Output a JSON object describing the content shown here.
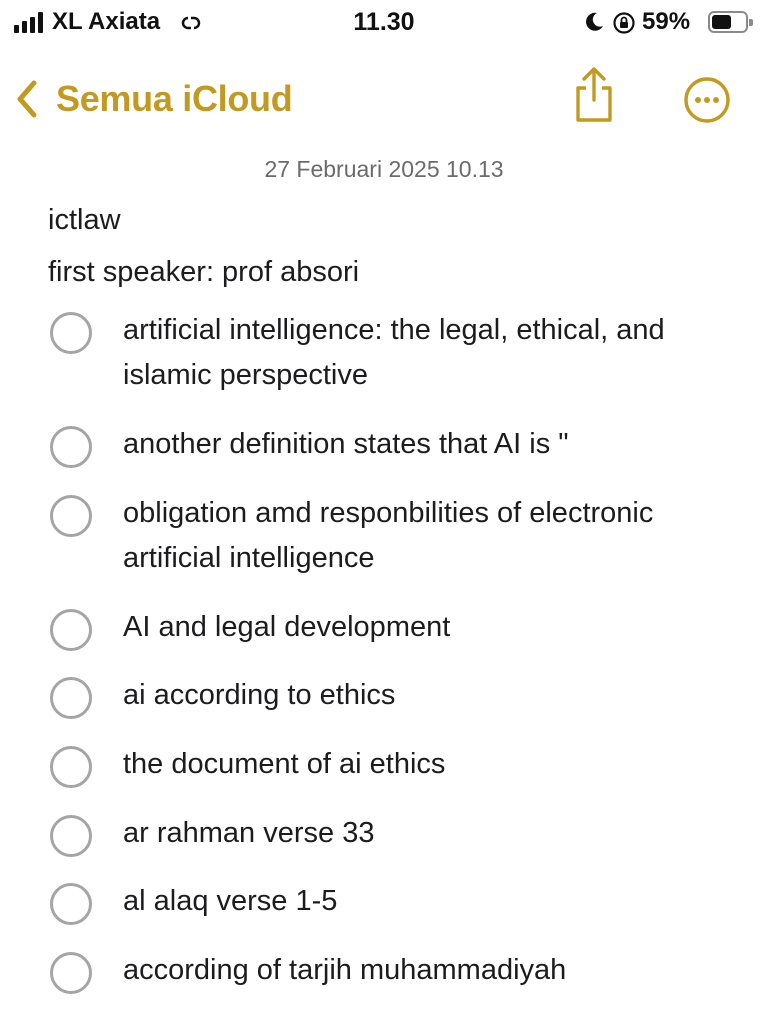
{
  "status_bar": {
    "carrier": "XL Axiata",
    "time": "11.30",
    "battery": "59%",
    "battery_level": 0.59,
    "icons": [
      "signal-icon",
      "hotspot-link-icon",
      "moon-icon",
      "orientation-lock-icon",
      "battery-icon"
    ]
  },
  "nav": {
    "back_label": "Semua iCloud",
    "accent_color": "#c29a1f",
    "icons": [
      "chevron-left-icon",
      "share-icon",
      "more-icon"
    ]
  },
  "note": {
    "date": "27 Februari 2025 10.13",
    "title": "ictlaw",
    "subtitle": "first speaker: prof absori",
    "checklist": [
      {
        "text": "artificial intelligence: the legal, ethical, and islamic perspective",
        "checked": false
      },
      {
        "text": "another definition states that AI is \"",
        "checked": false
      },
      {
        "text": "obligation amd responbilities of electronic artificial intelligence",
        "checked": false
      },
      {
        "text": "AI and legal development",
        "checked": false
      },
      {
        "text": "ai according to ethics",
        "checked": false
      },
      {
        "text": "the document of ai ethics",
        "checked": false
      },
      {
        "text": "ar rahman verse 33",
        "checked": false
      },
      {
        "text": "al alaq verse 1-5",
        "checked": false
      },
      {
        "text": "according of tarjih muhammadiyah",
        "checked": false
      }
    ]
  }
}
